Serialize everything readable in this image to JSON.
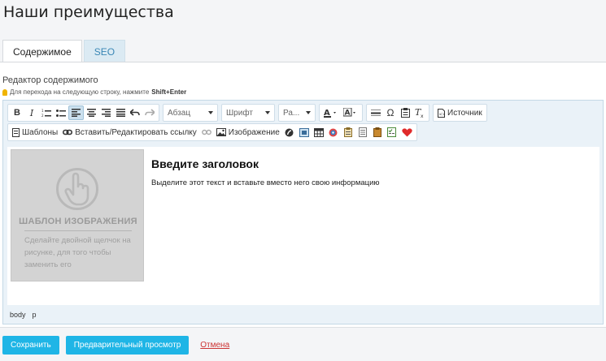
{
  "page": {
    "title": "Наши преимущества"
  },
  "tabs": [
    {
      "label": "Содержимое",
      "active": true
    },
    {
      "label": "SEO",
      "active": false
    }
  ],
  "editor": {
    "label": "Редактор содержимого",
    "hint_prefix": "Для перехода на следующую строку, нажмите",
    "hint_keys": "Shift+Enter",
    "toolbar": {
      "paragraph_dropdown": "Абзац",
      "font_dropdown": "Шрифт",
      "size_dropdown": "Ра...",
      "source_label": "Источник",
      "templates_label": "Шаблоны",
      "link_label": "Вставить/Редактировать ссылку",
      "image_label": "Изображение"
    },
    "content": {
      "placeholder_title": "ШАБЛОН ИЗОБРАЖЕНИЯ",
      "placeholder_text": "Сделайте двойной щелчок на рисунке, для того чтобы заменить его",
      "heading": "Введите заголовок",
      "body": "Выделите этот текст и вставьте вместо него свою информацию"
    },
    "statusbar": [
      "body",
      "p"
    ]
  },
  "footer": {
    "save_label": "Сохранить",
    "preview_label": "Предварительный просмотр",
    "cancel_label": "Отмена"
  },
  "colors": {
    "accent": "#1fb5e6",
    "cancel": "#cc3333",
    "tab_inactive": "#dbeaf3"
  }
}
